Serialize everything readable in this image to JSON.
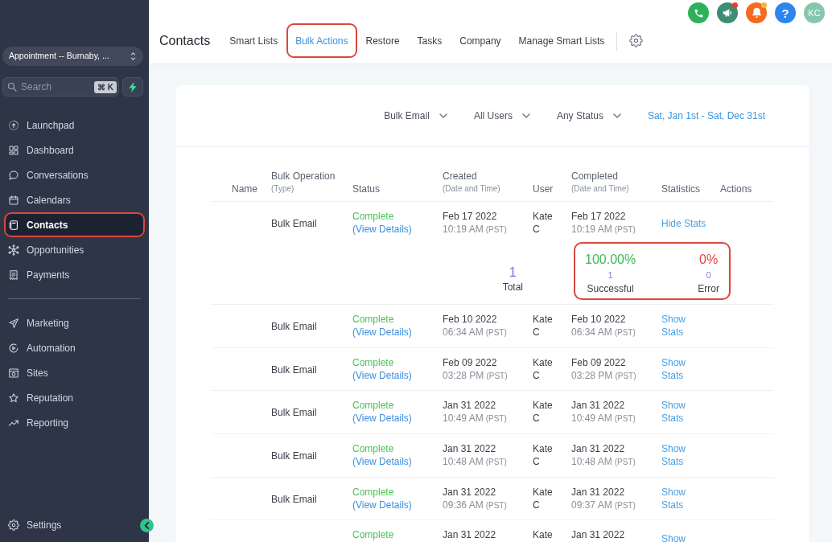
{
  "sidebar": {
    "location": "Appointment -- Burnaby, ...",
    "search": {
      "placeholder": "Search",
      "shortcut": "⌘ K"
    },
    "nav_sections": [
      {
        "items": [
          {
            "label": "Launchpad",
            "selected": false,
            "highlighted": false
          },
          {
            "label": "Dashboard",
            "selected": false,
            "highlighted": false
          },
          {
            "label": "Conversations",
            "selected": false,
            "highlighted": false
          },
          {
            "label": "Calendars",
            "selected": false,
            "highlighted": false
          },
          {
            "label": "Contacts",
            "selected": true,
            "highlighted": true
          },
          {
            "label": "Opportunities",
            "selected": false,
            "highlighted": false
          },
          {
            "label": "Payments",
            "selected": false,
            "highlighted": false
          }
        ]
      },
      {
        "items": [
          {
            "label": "Marketing",
            "selected": false,
            "highlighted": false
          },
          {
            "label": "Automation",
            "selected": false,
            "highlighted": false
          },
          {
            "label": "Sites",
            "selected": false,
            "highlighted": false
          },
          {
            "label": "Reputation",
            "selected": false,
            "highlighted": false
          },
          {
            "label": "Reporting",
            "selected": false,
            "highlighted": false
          }
        ]
      }
    ],
    "settings": {
      "label": "Settings"
    }
  },
  "header": {
    "title": "Contacts",
    "tabs": [
      {
        "label": "Smart Lists",
        "selected": false,
        "highlighted": false
      },
      {
        "label": "Bulk Actions",
        "selected": true,
        "highlighted": true
      },
      {
        "label": "Restore",
        "selected": false,
        "highlighted": false
      },
      {
        "label": "Tasks",
        "selected": false,
        "highlighted": false
      },
      {
        "label": "Company",
        "selected": false,
        "highlighted": false
      },
      {
        "label": "Manage Smart Lists",
        "selected": false,
        "highlighted": false
      }
    ],
    "actions": [
      {
        "kind": "phone",
        "color": "#2eb15a"
      },
      {
        "kind": "megaphone",
        "color": "#3d8c74",
        "badge": {
          "color": "#f03a2f"
        }
      },
      {
        "kind": "bell",
        "color": "#f46b1e",
        "badge": {
          "color": "#f7b43a"
        }
      },
      {
        "kind": "help",
        "color": "#2d86ee",
        "label": "?"
      }
    ],
    "avatar": {
      "initials": "KC"
    }
  },
  "filters": [
    {
      "kind": "dropdown",
      "label": "Bulk Email"
    },
    {
      "kind": "dropdown",
      "label": "All Users"
    },
    {
      "kind": "dropdown",
      "label": "Any Status"
    },
    {
      "kind": "date_range",
      "label": "Sat, Jan 1st - Sat, Dec 31st"
    }
  ],
  "table": {
    "columns": [
      {
        "title": "Name"
      },
      {
        "title": "Bulk Operation",
        "subtitle": "(Type)"
      },
      {
        "title": "Status"
      },
      {
        "title": "Created",
        "subtitle": "(Date and Time)"
      },
      {
        "title": "User"
      },
      {
        "title": "Completed",
        "subtitle": "(Date and Time)"
      },
      {
        "title": "Statistics"
      },
      {
        "title": "Actions"
      }
    ],
    "rows": [
      {
        "operation": "Bulk Email",
        "status": "Complete",
        "details_link": "(View Details)",
        "created": {
          "date": "Feb 17 2022",
          "time": "10:19 AM",
          "zone": "(PST)"
        },
        "user": "Kate C",
        "completed": {
          "date": "Feb 17 2022",
          "time": "10:19 AM",
          "zone": "(PST)"
        },
        "stats_link": "Hide Stats",
        "stats": {
          "total": "1",
          "total_label": "Total",
          "success_percent": "100.00%",
          "success_count": "1",
          "success_label": "Successful",
          "error_percent": "0%",
          "error_count": "0",
          "error_label": "Error",
          "highlighted": true
        }
      },
      {
        "operation": "Bulk Email",
        "status": "Complete",
        "details_link": "(View Details)",
        "created": {
          "date": "Feb 10 2022",
          "time": "06:34 AM",
          "zone": "(PST)"
        },
        "user": "Kate C",
        "completed": {
          "date": "Feb 10 2022",
          "time": "06:34 AM",
          "zone": "(PST)"
        },
        "stats_link": "Show Stats"
      },
      {
        "operation": "Bulk Email",
        "status": "Complete",
        "details_link": "(View Details)",
        "created": {
          "date": "Feb 09 2022",
          "time": "03:28 PM",
          "zone": "(PST)"
        },
        "user": "Kate C",
        "completed": {
          "date": "Feb 09 2022",
          "time": "03:28 PM",
          "zone": "(PST)"
        },
        "stats_link": "Show Stats"
      },
      {
        "operation": "Bulk Email",
        "status": "Complete",
        "details_link": "(View Details)",
        "created": {
          "date": "Jan 31 2022",
          "time": "10:49 AM",
          "zone": "(PST)"
        },
        "user": "Kate C",
        "completed": {
          "date": "Jan 31 2022",
          "time": "10:49 AM",
          "zone": "(PST)"
        },
        "stats_link": "Show Stats"
      },
      {
        "operation": "Bulk Email",
        "status": "Complete",
        "details_link": "(View Details)",
        "created": {
          "date": "Jan 31 2022",
          "time": "10:48 AM",
          "zone": "(PST)"
        },
        "user": "Kate C",
        "completed": {
          "date": "Jan 31 2022",
          "time": "10:48 AM",
          "zone": "(PST)"
        },
        "stats_link": "Show Stats"
      },
      {
        "operation": "Bulk Email",
        "status": "Complete",
        "details_link": "(View Details)",
        "created": {
          "date": "Jan 31 2022",
          "time": "09:36 AM",
          "zone": "(PST)"
        },
        "user": "Kate C",
        "completed": {
          "date": "Jan 31 2022",
          "time": "09:37 AM",
          "zone": "(PST)"
        },
        "stats_link": "Show Stats"
      },
      {
        "status": "Complete",
        "created": {
          "date": "Jan 31 2022"
        },
        "user": "Kate",
        "completed": {
          "date": "Jan 31 2022"
        },
        "stats_link": "Show"
      }
    ]
  }
}
